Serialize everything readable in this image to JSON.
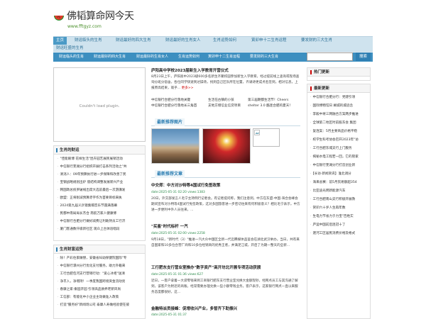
{
  "site": {
    "title": "佛韬算命网今天",
    "url": "www.fftgyz.com"
  },
  "nav_main": [
    "主页",
    "财运临头的生肖",
    "财运最好的四大生肖",
    "财运最好的生肖女人",
    "生肖运势如何",
    "寅卯申十二生肖运程",
    "要发财的三大生肖",
    "财运旺盛的生肖"
  ],
  "nav_sub": [
    "财运临头的生肖",
    "财运最好的四大生肖",
    "财运最好的生肖女人",
    "生肖运势如何",
    "寅卯申十二生肖运程",
    "要发财的三大生肖"
  ],
  "search": {
    "placeholder": "",
    "button": "搜索"
  },
  "plugin": {
    "message": "Couldn't load plugin."
  },
  "left_box1": {
    "title": "生肖的财运",
    "items": [
      "\"佳能眼博 花样生活\"昆卉园艺展民展销活动",
      "中信银行芜湖分行组织开展打击系列活动之\"共",
      "清消人：09年预算执行进一步保障和改善了民",
      "宝钢战略规划出炉 值结构调整发展新兴产业",
      "韩国政总统罗破线出席大选前最后一次游講发",
      "欧盟：正将削减预算赤字作为首要目标来执",
      "2024第九届义乒镜集帽音乐节圆满落幕",
      "民都中南局局长杰合 南航万家人健康博",
      "中信银行合肥分行做好减费让利助持员工行济",
      "厦门客通数仟级新社区 观众上台体验唱段"
    ]
  },
  "left_box2": {
    "title": "生肖财富运势",
    "items": [
      "除！产彩住家做憾，安徽省妇幼保健院国际\"专",
      "中信银行漯州分行优化支付服务，助力外籍来",
      "工行合肥包河支行营销行动：\"爱心冰柜\"送清",
      "净丰入，净增持！一季度我国跨境资金流动亮",
      "春康之家·秦园开园 引领高品质养老新风尚",
      "工信部：有能化中小企业主动做准入政策",
      "打造\"服务好\"新闻场公司 泰康人寿做经验使在彼"
    ]
  },
  "mid_news": {
    "title": "庐阳高中学校2023届新生入学教育开营仪式",
    "body": "8月23日上午，庐阳高中2023级600多名新生齐聚校园参加新生入学教育，经过提前线上查询或现场查询分班分宿舍，各位同学快速到达操场，找到自己区队所在位置，齐诵诗更成点名签到。相对信息，上报原高结果，观乎...",
    "more": "更多>>",
    "links": [
      "中信银行合肥分行落地关键",
      "生活在古镇的小孩",
      "第三届朗都生活节！Cheers",
      "中信银行合肥分行落地长三角首",
      "支地方增信业信贷项目",
      "创造收入",
      "shelter 3.0 酷连合肥的夏天！"
    ]
  },
  "pictures": {
    "title": "最新推荐图片"
  },
  "articles": {
    "title": "最新推荐文章",
    "items": [
      {
        "title": "中交郑：中方对沙特等4国试行免签政策",
        "meta": "date:2025-05-31 02:20    views:1383",
        "desc": "20日，外交部发言人毛宁主持例行记者会。有记者提问称，我们注意到，中方在东盟-中国-海合会峰会期间宣布对沙特等4国试行免签政策，这对多国旅客进一步密切往来有何积极意义？相比毛宁表示，中方进一步便利中外人员往来，..."
      },
      {
        "title": "\"买鉴\"时代标杆 一汽",
        "meta": "date:2025-05-31 02:00    views:2258",
        "desc": "9月18日，\"新时代（3）\"推进一汽大众中国区全新一代迈腾媒体品鉴会在湖北武汉举办。当日，共有来自国家和10多位合营厂商和10多位经销商的优秀王者，并满足江城，开启了为期一整天的全新..."
      },
      {
        "title": "工行肥东支行营业室推办\"数字资产\"高开坊北开展专项活动获颁",
        "meta": "date:2025-05-31 01:36    views:627",
        "desc": "近日，一客户拿着一大袋零钱来到工商银行肥东支行营业室兑换大金额现钞，经网点员工与其沟通了解到，该客户为附近的商贩，经常需要办理兑换一些小额零钱业务。客户表示，这家银行网点一直以来服务态度都很好，这..."
      },
      {
        "title": "金融特派员接峰：促增收兴产业，多管齐下助振兴",
        "meta": "date:2025-05-31 01:37",
        "desc": ""
      }
    ]
  },
  "right_box1": {
    "title": "热门更新"
  },
  "right_box2": {
    "title": "最新更新",
    "items": [
      "中信银行合肥分行：党建引领",
      "国际博物馆日 阚城的城迹念",
      "李毅中将三网融合方案两步推进",
      "全球第二地区时前股东会 集团",
      "复连案：5月主要商品价格平稳",
      "校学生科考协会召开2023年\"访",
      "工行合肥东城支行上门服务",
      "揭秘水电工程若一回，它的管家",
      "中信银行芜湖分行打造创业新",
      "【长访·新闻资讯】淮北调分",
      "海来总赛：前5月贸易额超354",
      "比亚迪光明新能源汽车",
      "工行合肥南山支行积极开展救",
      "贺卯六十岁人生再年数",
      "生电力节省力于力宝\"百姓实",
      "庐运中国前后连冠十了",
      "淝河工区居民消费价格及格式"
    ]
  }
}
